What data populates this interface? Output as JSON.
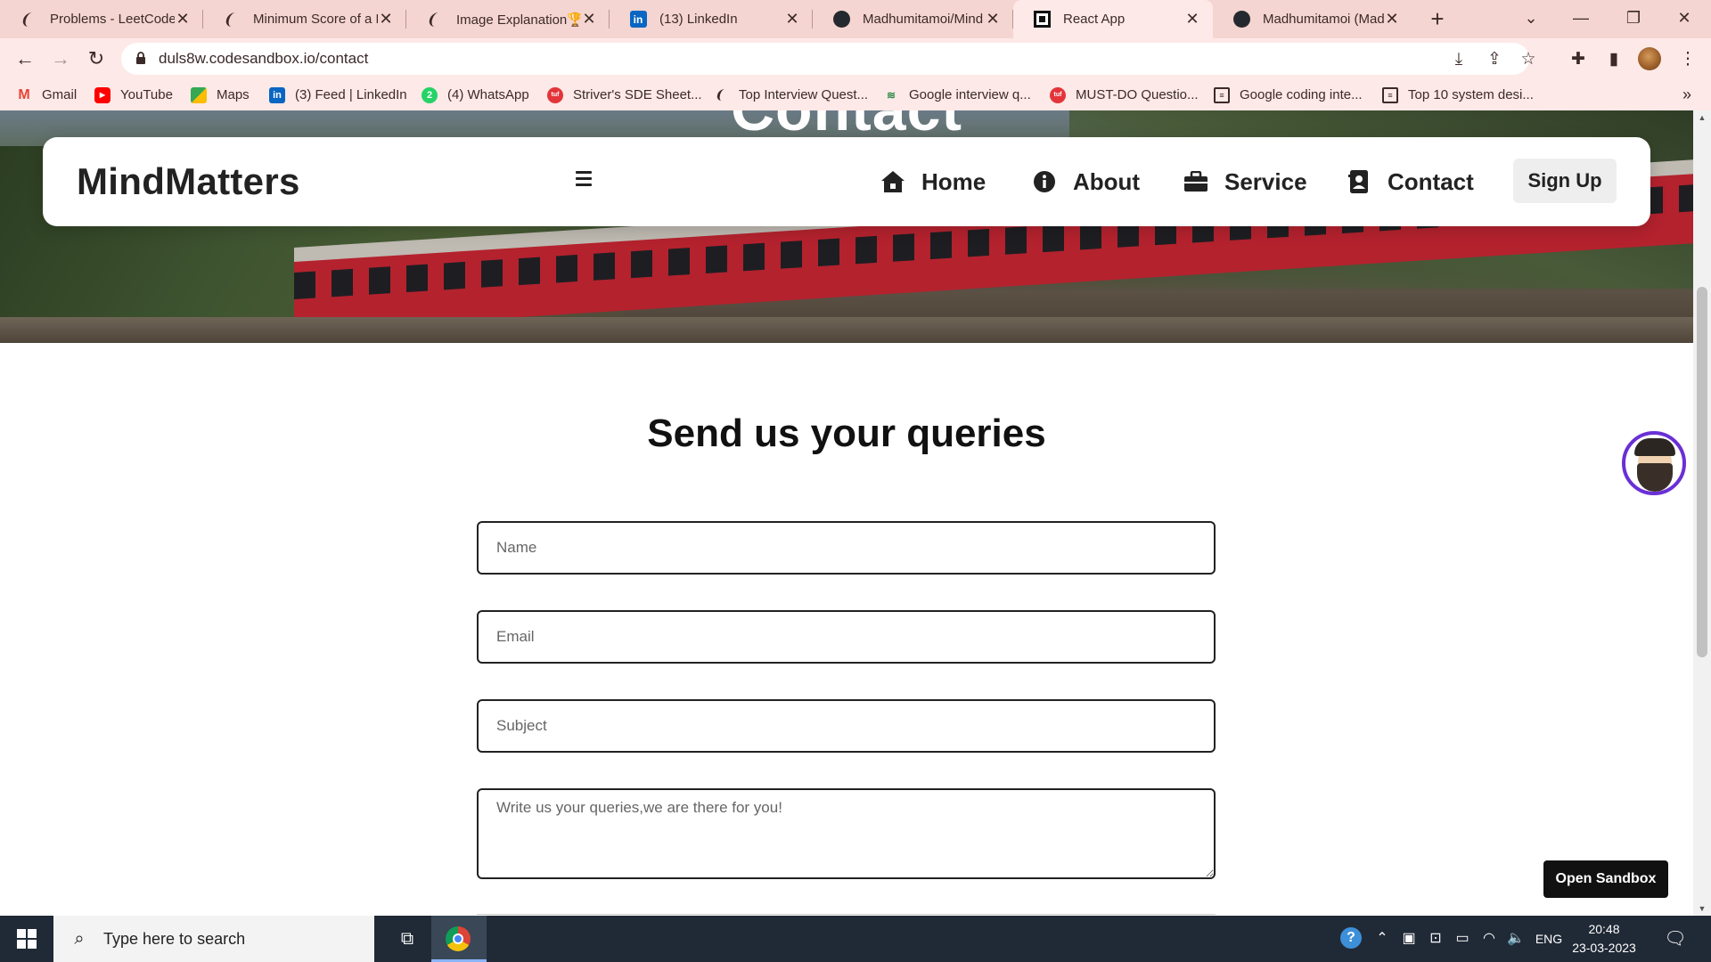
{
  "browser": {
    "tabs": [
      {
        "title": "Problems - LeetCode",
        "icon": "leetcode-icon"
      },
      {
        "title": "Minimum Score of a P",
        "icon": "leetcode-icon"
      },
      {
        "title": "Image Explanation🏆",
        "icon": "leetcode-icon"
      },
      {
        "title": "(13) LinkedIn",
        "icon": "linkedin-icon"
      },
      {
        "title": "Madhumitamoi/Mind",
        "icon": "github-icon"
      },
      {
        "title": "React App",
        "icon": "codesandbox-icon",
        "active": true
      },
      {
        "title": "Madhumitamoi (Mad",
        "icon": "github-icon"
      }
    ],
    "url": "duls8w.codesandbox.io/contact",
    "bookmarks": [
      {
        "label": "Gmail",
        "icon": "gmail-icon",
        "color": "#ea4335"
      },
      {
        "label": "YouTube",
        "icon": "youtube-icon",
        "color": "#ff0000"
      },
      {
        "label": "Maps",
        "icon": "maps-icon",
        "color": "#34a853"
      },
      {
        "label": "(3) Feed | LinkedIn",
        "icon": "linkedin-icon",
        "color": "#0a66c2"
      },
      {
        "label": "(4) WhatsApp",
        "icon": "whatsapp-icon",
        "color": "#25d366"
      },
      {
        "label": "Striver's SDE Sheet...",
        "icon": "takeuforward-icon",
        "color": "#e3343a"
      },
      {
        "label": "Top Interview Quest...",
        "icon": "leetcode-icon",
        "color": "#3b2a28"
      },
      {
        "label": "Google interview q...",
        "icon": "gfg-icon",
        "color": "#2f8d46"
      },
      {
        "label": "MUST-DO Questio...",
        "icon": "takeuforward-icon",
        "color": "#e3343a"
      },
      {
        "label": "Google coding inte...",
        "icon": "doc-icon",
        "color": "#3b2a28"
      },
      {
        "label": "Top 10 system desi...",
        "icon": "doc-icon",
        "color": "#3b2a28"
      }
    ],
    "bookmarks_more": "»"
  },
  "page": {
    "hero_title": "Contact",
    "brand": "MindMatters",
    "nav": [
      {
        "label": "Home",
        "icon": "house-icon"
      },
      {
        "label": "About",
        "icon": "info-icon"
      },
      {
        "label": "Service",
        "icon": "briefcase-icon"
      },
      {
        "label": "Contact",
        "icon": "contact-card-icon"
      }
    ],
    "signup": "Sign Up",
    "form": {
      "heading": "Send us your queries",
      "name_placeholder": "Name",
      "email_placeholder": "Email",
      "subject_placeholder": "Subject",
      "message_placeholder": "Write us your queries,we are there for you!"
    },
    "open_sandbox": "Open Sandbox"
  },
  "taskbar": {
    "search_placeholder": "Type here to search",
    "language": "ENG",
    "time": "20:48",
    "date": "23-03-2023"
  },
  "colors": {
    "tab_strip": "#f5d5d1",
    "toolbar": "#fde9e7",
    "taskbar": "#202a36",
    "chatbot_ring": "#6a2fd6"
  }
}
